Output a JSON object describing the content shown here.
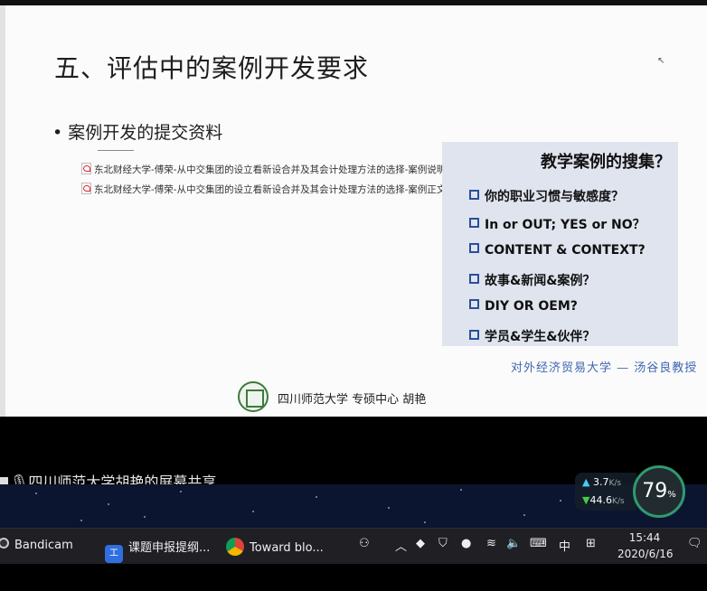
{
  "slide": {
    "title": "五、评估中的案例开发要求",
    "bullet": "案例开发的提交资料",
    "files": [
      "东北财经大学-傅荣-从中交集团的设立看新设合并及其会计处理方法的选择-案例说明书.pdf",
      "东北财经大学-傅荣-从中交集团的设立看新设合并及其会计处理方法的选择-案例正文.pdf"
    ],
    "panel": {
      "title": "教学案例的搜集？",
      "items": [
        "你的职业习惯与敏感度？",
        "In  or  OUT;  YES  or  NO？",
        "CONTENT  &  CONTEXT?",
        "故事&新闻&案例？",
        "DIY  OR  OEM?",
        "学员&学生&伙伴？"
      ],
      "accent": "#2a4f9b"
    },
    "credit": "对外经济贸易大学 — 汤谷良教授",
    "footer": "四川师范大学 专硕中心  胡艳"
  },
  "share_banner": "四川师范大学胡艳的屏幕共享",
  "network": {
    "up": "3.7",
    "down": "44.6",
    "unit": "K/s"
  },
  "gauge": {
    "value": "79",
    "unit": "%"
  },
  "taskbar": {
    "apps": [
      {
        "label": "Bandicam",
        "icon": "bandicam-icon"
      },
      {
        "label": "课题申报提纲...",
        "icon": "wps-icon"
      },
      {
        "label": "Toward blo...",
        "icon": "chrome-icon"
      }
    ],
    "ime": "中",
    "time": "15:44",
    "date": "2020/6/16"
  }
}
